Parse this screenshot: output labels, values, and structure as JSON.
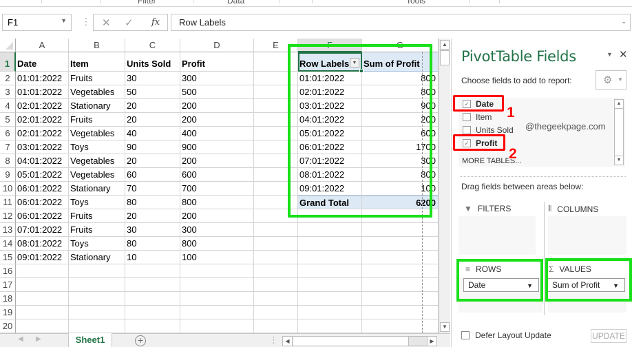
{
  "ribbon": {
    "groups": [
      "Filter",
      "Data",
      "Tools"
    ]
  },
  "formula_bar": {
    "name_box": "F1",
    "cancel_icon": "✕",
    "enter_icon": "✓",
    "fx_label": "fx",
    "content": "Row Labels"
  },
  "grid": {
    "columns": [
      "A",
      "B",
      "C",
      "D",
      "E",
      "F",
      "G"
    ],
    "selected_column": "F",
    "row_numbers": [
      "1",
      "2",
      "3",
      "4",
      "5",
      "6",
      "7",
      "8",
      "9",
      "10",
      "11",
      "12",
      "13",
      "14",
      "15",
      "16",
      "17",
      "18",
      "19",
      "20"
    ],
    "headers": [
      "Date",
      "Item",
      "Units Sold",
      "Profit"
    ],
    "rows": [
      [
        "01:01:2022",
        "Fruits",
        "30",
        "300"
      ],
      [
        "01:01:2022",
        "Vegetables",
        "50",
        "500"
      ],
      [
        "02:01:2022",
        "Stationary",
        "20",
        "200"
      ],
      [
        "02:01:2022",
        "Fruits",
        "20",
        "200"
      ],
      [
        "02:01:2022",
        "Vegetables",
        "40",
        "400"
      ],
      [
        "03:01:2022",
        "Toys",
        "90",
        "900"
      ],
      [
        "04:01:2022",
        "Vegetables",
        "20",
        "200"
      ],
      [
        "05:01:2022",
        "Vegetables",
        "60",
        "600"
      ],
      [
        "06:01:2022",
        "Stationary",
        "70",
        "700"
      ],
      [
        "06:01:2022",
        "Toys",
        "80",
        "800"
      ],
      [
        "06:01:2022",
        "Fruits",
        "20",
        "200"
      ],
      [
        "07:01:2022",
        "Fruits",
        "30",
        "300"
      ],
      [
        "08:01:2022",
        "Toys",
        "80",
        "800"
      ],
      [
        "09:01:2022",
        "Stationary",
        "10",
        "100"
      ]
    ]
  },
  "pivot": {
    "row_labels_header": "Row Labels",
    "value_header": "Sum of Profit",
    "rows": [
      {
        "label": "01:01:2022",
        "value": "800"
      },
      {
        "label": "02:01:2022",
        "value": "800"
      },
      {
        "label": "03:01:2022",
        "value": "900"
      },
      {
        "label": "04:01:2022",
        "value": "200"
      },
      {
        "label": "05:01:2022",
        "value": "600"
      },
      {
        "label": "06:01:2022",
        "value": "1700"
      },
      {
        "label": "07:01:2022",
        "value": "300"
      },
      {
        "label": "08:01:2022",
        "value": "800"
      },
      {
        "label": "09:01:2022",
        "value": "100"
      }
    ],
    "grand_total_label": "Grand Total",
    "grand_total_value": "6200"
  },
  "sheet_tabs": {
    "active": "Sheet1",
    "add_label": "+"
  },
  "panel": {
    "title": "PivotTable Fields",
    "choose_label": "Choose fields to add to report:",
    "fields": [
      {
        "name": "Date",
        "checked": true
      },
      {
        "name": "Item",
        "checked": false
      },
      {
        "name": "Units Sold",
        "checked": false
      },
      {
        "name": "Profit",
        "checked": true
      }
    ],
    "more_tables": "MORE TABLES...",
    "watermark": "@thegeekpage.com",
    "drag_label": "Drag fields between areas below:",
    "areas": {
      "filters": "FILTERS",
      "columns": "COLUMNS",
      "rows": "ROWS",
      "values": "VALUES"
    },
    "rows_field": "Date",
    "values_field": "Sum of Profit",
    "defer_label": "Defer Layout Update",
    "update_label": "UPDATE"
  },
  "annotations": {
    "step1": "1",
    "step2": "2",
    "highlight_color": "#19e019",
    "callout_color": "#ff0000"
  }
}
